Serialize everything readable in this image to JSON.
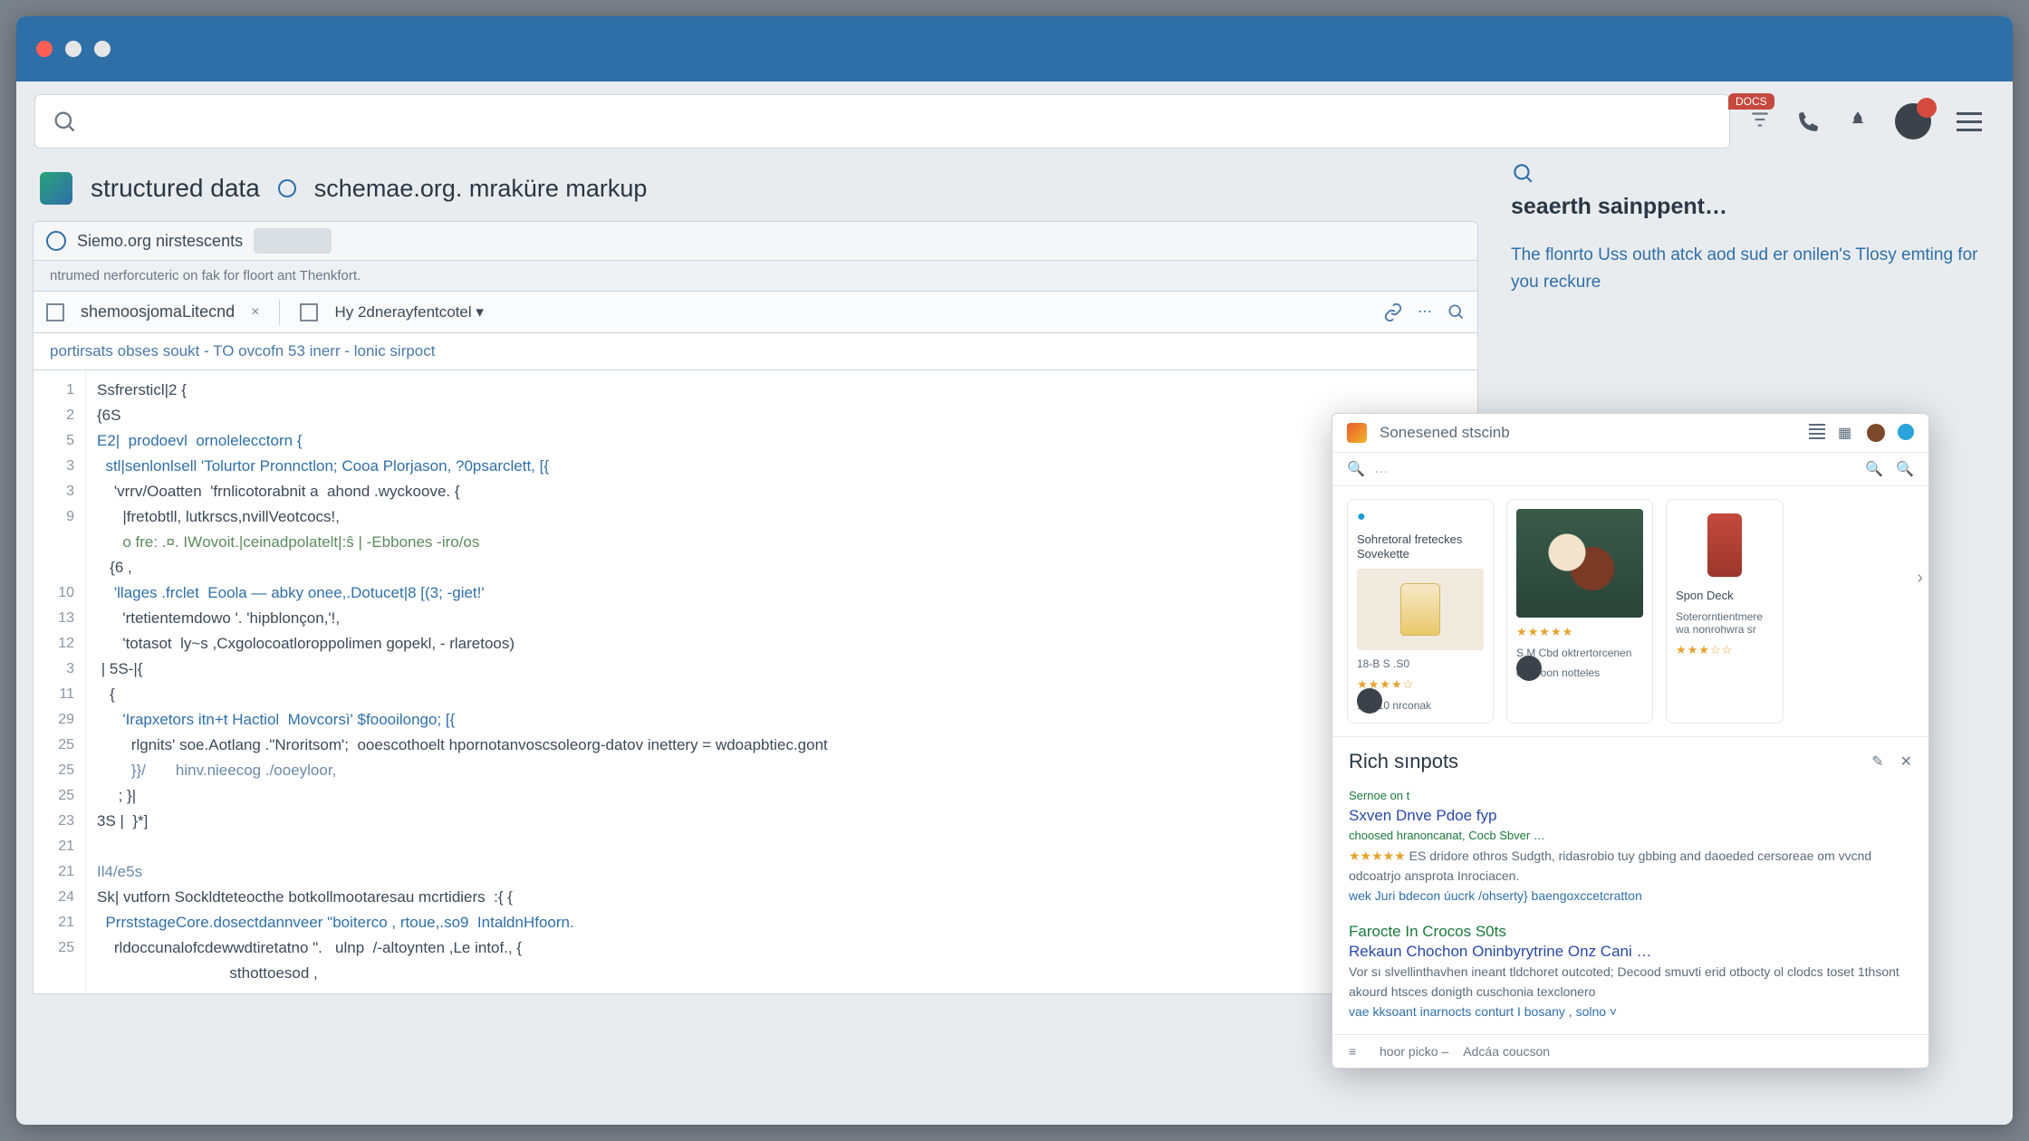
{
  "window": {
    "badge_text": "DOCS"
  },
  "crumbs": {
    "left": "structured data",
    "right": "schemae.org.  mraküre markup"
  },
  "tab_strip": {
    "label": "Siemo.org nirstescents",
    "sub": "ntrumed nerforcuteric on fak for floort ant Thenkfort."
  },
  "file": {
    "name": "shemoosjomaLitecnd",
    "dropdown": "Hy 2dnerayfentcotel",
    "path": "portirsats  obses  soukt  -  TO  ovcofn  53 inerr  -  lonic  sirpoct"
  },
  "code": {
    "lines": [
      "Ssfrersticl|2 {",
      "{6S",
      "E2|  prodoevl  ornolelecctorn {",
      "  stl|senlonlsell 'Tolurtor Pronnctlon; Cooa Plorjason, ?0psarclett, [{",
      "    'vrrv/Ooattеn  'frnlicotorabnit a  ahond .wyckoove. {",
      "      |fretobtll, lutkrscs,nvillVeotcocs!,",
      "      o fre: .¤. IWоvoit.|ceinadpolatelt|:ŝ | -Ebbones -iro/os",
      "   {6 ,",
      "    'llages .frclet  Eoola — abky onee,.Dotucet|8 [(3; -giet!'",
      "      'rtetientemdowo '. 'hipblonçon,'!,",
      "      'totasot  ly~s ,Cxgolocoatloroppolimen gopekl, - rlaretoos)",
      " | 5S-|{",
      "   {",
      "      'Irapxetors itn+t Hactiol  Movcorsì' $foooilongo; [{",
      "        rlgnits' soe.Aotlang .\"Nroritsom';  ooescothoelt hpornotanvoscsoleorg-datov inettery = wdoapbtiec.gont",
      "        }}/       hinv.nieecog ./ooeyloor,",
      "     ; }|",
      "3S |  }*]",
      "",
      "Il4/e5s",
      "Sk| vutforn Sockldteteocthe botkollmootaresau mcrtidiers  :{ {",
      "  PrrststageCore.dosectdannveer \"boiterco , rtoue,.so9  IntaldnHfoorn.",
      "    rldoccunalofcdewwdtiretatno \".   ulnp  /-altoynten ,Le intof., {",
      "                               sthottoesod ,"
    ]
  },
  "side": {
    "placeholder": "seaerth sainppent…",
    "desc": "The flonrto Uss outh atck aod sud er onilen's Tlosy emting for you reckure"
  },
  "popup": {
    "header": "Sonesened stscinb",
    "cards": [
      {
        "title": "Sohretoral freteckes Sovekette",
        "price": "18-B S .S0",
        "meta": "1sd.10 nrconak"
      },
      {
        "title": "",
        "price": "S.M Cbd oktrertorcenen",
        "meta": "otncroon notteles"
      },
      {
        "title": "Spon Deck",
        "price": "",
        "meta": "Soterorntientmere wa nonrohwra sr"
      }
    ],
    "section_title": "Rich sınpots",
    "results": [
      {
        "site": "Sernoe on t",
        "title": "Sxven Dnve Pdoe fyp",
        "sub": "choosed hranoncanat, Cocb Sbver …",
        "desc": "ES dridore othros Sudgth, ridasrobio tuy gbbing and daoeded cersoreae om vvcnd odcoatrjo ansprota Inrociacen.",
        "more": "wek Juri bdecon úucrk  /ohserty} baengoxccetcratton"
      },
      {
        "site": "",
        "title": "Farocte In Crocos S0ts",
        "sub": "Rekaun Chochon Oninbyrytrine Onz Cani …",
        "desc": "Vor sı slvellinthavhen ineant tldchoret outcoted; Decood smuvti erid otbocty ol clodcs toset 1thsont akourd  htsces donigth cuschonia texclonero",
        "more": "vae kksoant inarnocts conturt I bosany , solno  ˅"
      }
    ],
    "footer": {
      "left": "hoor picko –",
      "right": "Adcáa coucson"
    }
  }
}
